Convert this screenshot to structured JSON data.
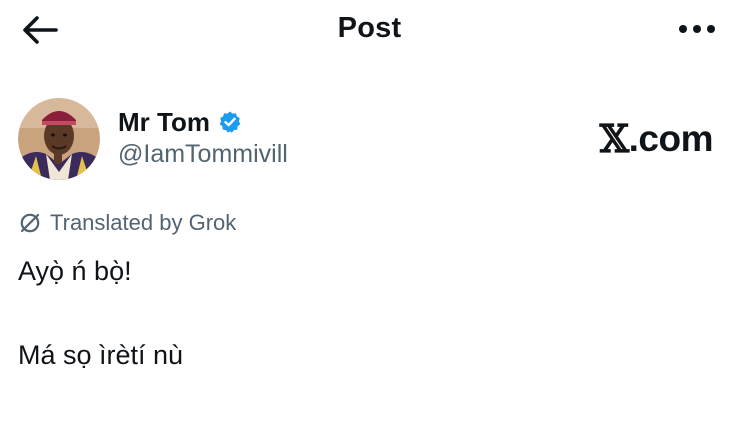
{
  "header": {
    "title": "Post",
    "back_icon": "arrow-left-icon",
    "more_icon": "more-horizontal-icon"
  },
  "author": {
    "display_name": "Mr Tom",
    "handle": "@IamTommivill",
    "verified_icon": "verified-badge-icon",
    "verified_color": "#1d9bf0"
  },
  "watermark": {
    "mark": "𝕏",
    "text": ".com"
  },
  "translation": {
    "icon": "grok-icon",
    "label": "Translated by Grok"
  },
  "post": {
    "lines": [
      "Ayọ̀ ń bọ̀!",
      "Má sọ ìrètí nù"
    ]
  },
  "colors": {
    "text_primary": "#0f1419",
    "text_secondary": "#536471",
    "accent": "#1d9bf0"
  }
}
